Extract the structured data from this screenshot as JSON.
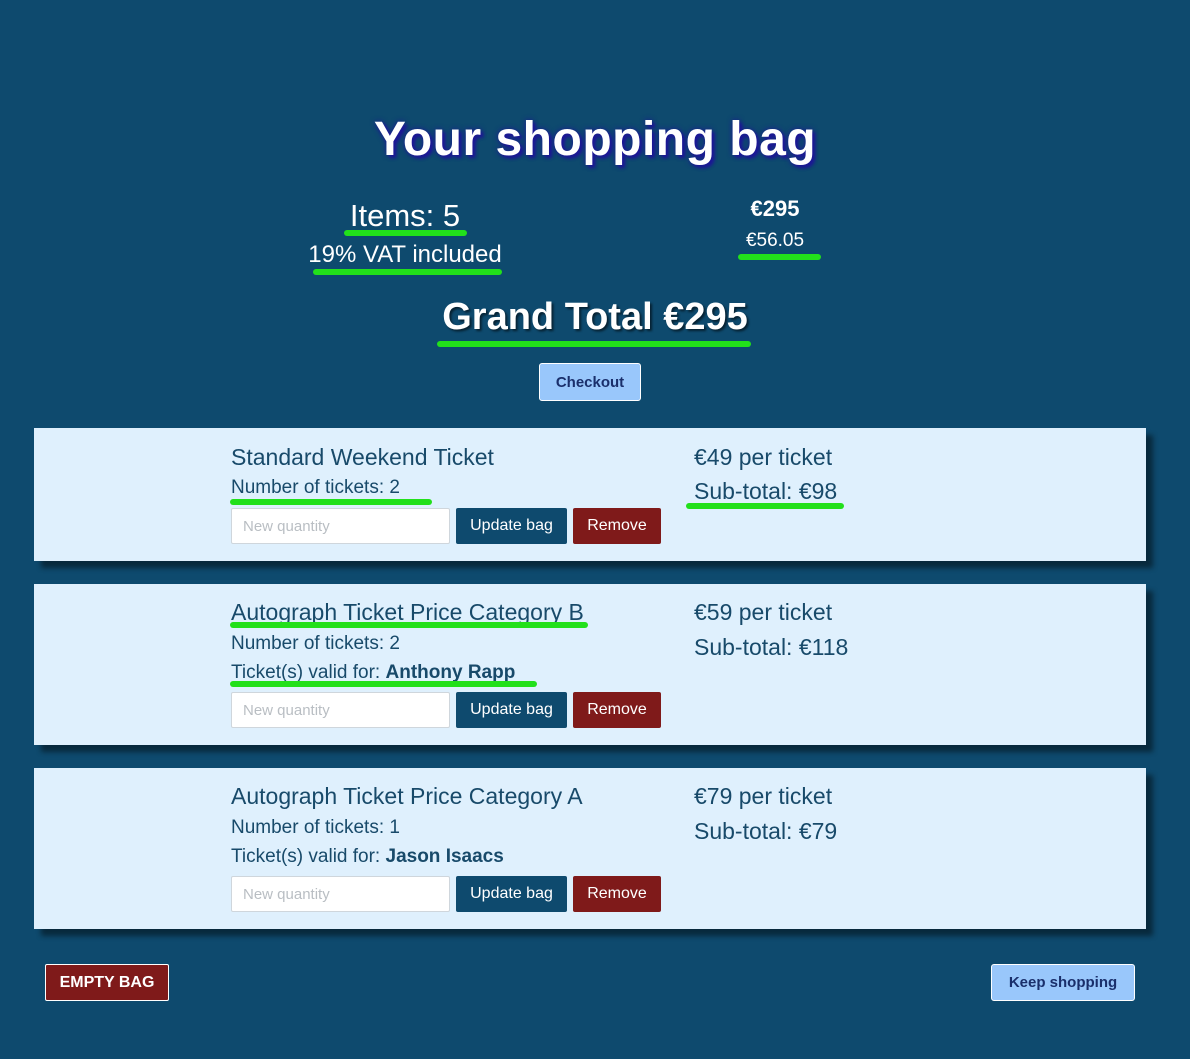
{
  "header": {
    "title": "Your shopping bag",
    "items_label": "Items: 5",
    "vat_label": "19% VAT included",
    "bag_total": "€295",
    "vat_amount": "€56.05",
    "grand_total": "Grand Total €295",
    "checkout_label": "Checkout"
  },
  "items": [
    {
      "name": "Standard Weekend Ticket",
      "quantity_line": "Number of tickets: 2",
      "price_per_ticket": "€49 per ticket",
      "subtotal": "Sub-total: €98",
      "qty_placeholder": "New quantity",
      "update_label": "Update bag",
      "remove_label": "Remove"
    },
    {
      "name": "Autograph Ticket Price Category B",
      "quantity_line": "Number of tickets: 2",
      "valid_prefix": "Ticket(s) valid for: ",
      "valid_for": "Anthony Rapp",
      "price_per_ticket": "€59 per ticket",
      "subtotal": "Sub-total: €118",
      "qty_placeholder": "New quantity",
      "update_label": "Update bag",
      "remove_label": "Remove"
    },
    {
      "name": "Autograph Ticket Price Category A",
      "quantity_line": "Number of tickets: 1",
      "valid_prefix": "Ticket(s) valid for: ",
      "valid_for": "Jason Isaacs",
      "price_per_ticket": "€79 per ticket",
      "subtotal": "Sub-total: €79",
      "qty_placeholder": "New quantity",
      "update_label": "Update bag",
      "remove_label": "Remove"
    }
  ],
  "footer": {
    "empty_bag_label": "EMPTY BAG",
    "keep_shopping_label": "Keep shopping"
  },
  "colors": {
    "background": "#0e4a6e",
    "card_background": "#dff0fd",
    "highlight": "#22e01b",
    "remove_red": "#7f1a1a",
    "light_button": "#99c7fb"
  }
}
